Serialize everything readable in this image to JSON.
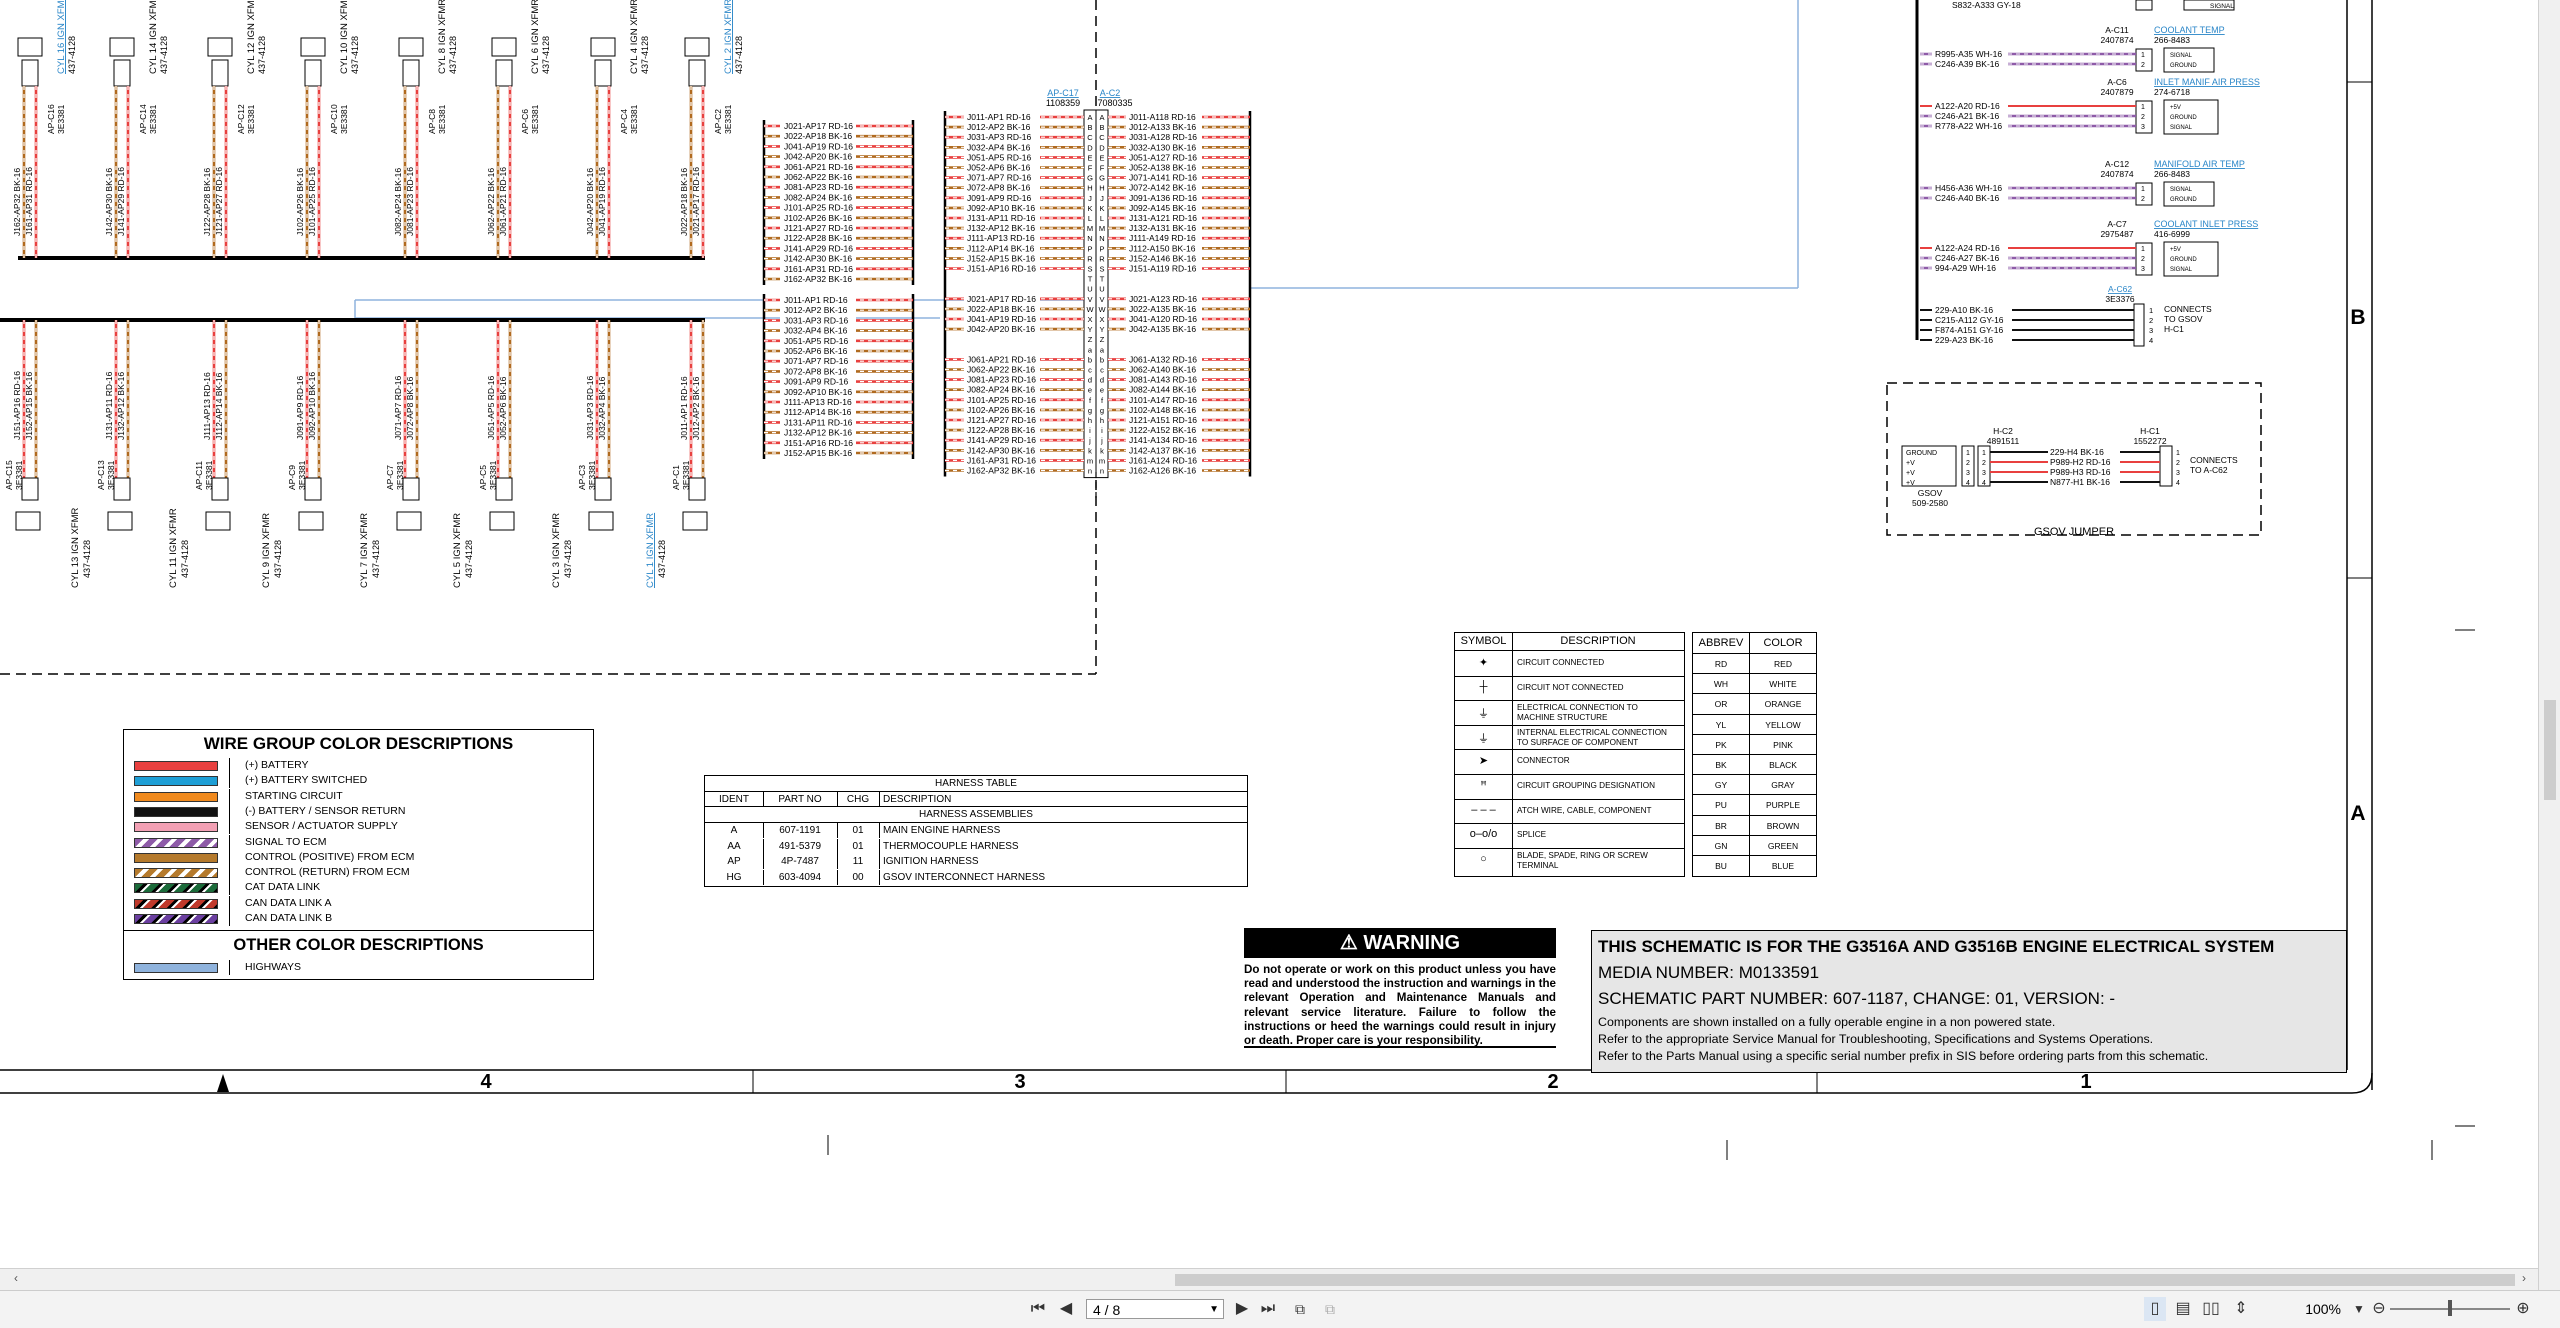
{
  "viewer": {
    "page_current": "4 / 8",
    "zoom_level": "100%"
  },
  "zones": {
    "columns": [
      "4",
      "3",
      "2",
      "1"
    ],
    "rows": [
      "B",
      "A"
    ]
  },
  "cylinders_top": [
    {
      "label": "CYL 16 IGN XFMR",
      "sub": "437-4128",
      "conn": "AP-C16",
      "part": "3E3381",
      "wires": [
        "J162-AP32 BK-16",
        "J161-AP31 RD-16"
      ],
      "link": true
    },
    {
      "label": "CYL 14 IGN XFMR",
      "sub": "437-4128",
      "conn": "AP-C14",
      "part": "3E3381",
      "wires": [
        "J142-AP30 BK-16",
        "J141-AP29 RD-16"
      ],
      "link": false
    },
    {
      "label": "CYL 12 IGN XFMR",
      "sub": "437-4128",
      "conn": "AP-C12",
      "part": "3E3381",
      "wires": [
        "J122-AP28 BK-16",
        "J121-AP27 RD-16"
      ],
      "link": false
    },
    {
      "label": "CYL 10 IGN XFMR",
      "sub": "437-4128",
      "conn": "AP-C10",
      "part": "3E3381",
      "wires": [
        "J102-AP26 BK-16",
        "J101-AP25 RD-16"
      ],
      "link": false
    },
    {
      "label": "CYL 8 IGN XFMR",
      "sub": "437-4128",
      "conn": "AP-C8",
      "part": "3E3381",
      "wires": [
        "J082-AP24 BK-16",
        "J081-AP23 RD-16"
      ],
      "link": false
    },
    {
      "label": "CYL 6 IGN XFMR",
      "sub": "437-4128",
      "conn": "AP-C6",
      "part": "3E3381",
      "wires": [
        "J062-AP22 BK-16",
        "J061-AP21 RD-16"
      ],
      "link": false
    },
    {
      "label": "CYL 4 IGN XFMR",
      "sub": "437-4128",
      "conn": "AP-C4",
      "part": "3E3381",
      "wires": [
        "J042-AP20 BK-16",
        "J041-AP19 RD-16"
      ],
      "link": false
    },
    {
      "label": "CYL 2 IGN XFMR",
      "sub": "437-4128",
      "conn": "AP-C2",
      "part": "3E3381",
      "wires": [
        "J022-AP18 BK-16",
        "J021-AP17 RD-16"
      ],
      "link": true
    }
  ],
  "cylinders_bottom": [
    {
      "label": "CYL 15 IGN XFMR",
      "sub": "437-4128",
      "conn": "AP-C15",
      "part": "3E3381",
      "wires": [
        "J151-AP16 RD-16",
        "J152-AP15 BK-16"
      ],
      "link": false
    },
    {
      "label": "CYL 13 IGN XFMR",
      "sub": "437-4128",
      "conn": "AP-C13",
      "part": "3E3381",
      "wires": [
        "J131-AP11 RD-16",
        "J132-AP12 BK-16"
      ],
      "link": false
    },
    {
      "label": "CYL 11 IGN XFMR",
      "sub": "437-4128",
      "conn": "AP-C11",
      "part": "3E3381",
      "wires": [
        "J111-AP13 RD-16",
        "J112-AP14 BK-16"
      ],
      "link": false
    },
    {
      "label": "CYL 9 IGN XFMR",
      "sub": "437-4128",
      "conn": "AP-C9",
      "part": "3E3381",
      "wires": [
        "J091-AP9 RD-16",
        "J092-AP10 BK-16"
      ],
      "link": false
    },
    {
      "label": "CYL 7 IGN XFMR",
      "sub": "437-4128",
      "conn": "AP-C7",
      "part": "3E3381",
      "wires": [
        "J071-AP7 RD-16",
        "J072-AP8 BK-16"
      ],
      "link": false
    },
    {
      "label": "CYL 5 IGN XFMR",
      "sub": "437-4128",
      "conn": "AP-C5",
      "part": "3E3381",
      "wires": [
        "J051-AP5 RD-16",
        "J052-AP6 BK-16"
      ],
      "link": false
    },
    {
      "label": "CYL 3 IGN XFMR",
      "sub": "437-4128",
      "conn": "AP-C3",
      "part": "3E3381",
      "wires": [
        "J031-AP3 RD-16",
        "J032-AP4 BK-16"
      ],
      "link": false
    },
    {
      "label": "CYL 1 IGN XFMR",
      "sub": "437-4128",
      "conn": "AP-C1",
      "part": "3E3381",
      "wires": [
        "J011-AP1 RD-16",
        "J012-AP2 BK-16"
      ],
      "link": true
    }
  ],
  "splice_group_upper": [
    "J021-AP17 RD-16",
    "J022-AP18 BK-16",
    "J041-AP19 RD-16",
    "J042-AP20 BK-16",
    "J061-AP21 RD-16",
    "J062-AP22 BK-16",
    "J081-AP23 RD-16",
    "J082-AP24 BK-16",
    "J101-AP25 RD-16",
    "J102-AP26 BK-16",
    "J121-AP27 RD-16",
    "J122-AP28 BK-16",
    "J141-AP29 RD-16",
    "J142-AP30 BK-16",
    "J161-AP31 RD-16",
    "J162-AP32 BK-16"
  ],
  "splice_group_lower": [
    "J011-AP1 RD-16",
    "J012-AP2 BK-16",
    "J031-AP3 RD-16",
    "J032-AP4 BK-16",
    "J051-AP5 RD-16",
    "J052-AP6 BK-16",
    "J071-AP7 RD-16",
    "J072-AP8 BK-16",
    "J091-AP9 RD-16",
    "J092-AP10 BK-16",
    "J111-AP13 RD-16",
    "J112-AP14 BK-16",
    "J131-AP11 RD-16",
    "J132-AP12 BK-16",
    "J151-AP16 RD-16",
    "J152-AP15 BK-16"
  ],
  "connector_apc17": {
    "name": "AP-C17",
    "part": "1108359"
  },
  "connector_ac2": {
    "name": "A-C2",
    "part": "7080335"
  },
  "apc17_left": [
    "J011-AP1 RD-16",
    "J012-AP2 BK-16",
    "J031-AP3 RD-16",
    "J032-AP4 BK-16",
    "J051-AP5 RD-16",
    "J052-AP6 BK-16",
    "J071-AP7 RD-16",
    "J072-AP8 BK-16",
    "J091-AP9 RD-16",
    "J092-AP10 BK-16",
    "J131-AP11 RD-16",
    "J132-AP12 BK-16",
    "J111-AP13 RD-16",
    "J112-AP14 BK-16",
    "J152-AP15 BK-16",
    "J151-AP16 RD-16",
    "",
    "",
    "J021-AP17 RD-16",
    "J022-AP18 BK-16",
    "J041-AP19 RD-16",
    "J042-AP20 BK-16",
    "",
    "",
    "J061-AP21 RD-16",
    "J062-AP22 BK-16",
    "J081-AP23 RD-16",
    "J082-AP24 BK-16",
    "J101-AP25 RD-16",
    "J102-AP26 BK-16",
    "J121-AP27 RD-16",
    "J122-AP28 BK-16",
    "J141-AP29 RD-16",
    "J142-AP30 BK-16",
    "J161-AP31 RD-16",
    "J162-AP32 BK-16"
  ],
  "ac2_right": [
    "J011-A118 RD-16",
    "J012-A133 BK-16",
    "J031-A128 RD-16",
    "J032-A130 BK-16",
    "J051-A127 RD-16",
    "J052-A138 BK-16",
    "J071-A141 RD-16",
    "J072-A142 BK-16",
    "J091-A136 RD-16",
    "J092-A145 BK-16",
    "J131-A121 RD-16",
    "J132-A131 BK-16",
    "J111-A149 RD-16",
    "J112-A150 BK-16",
    "J152-A146 BK-16",
    "J151-A119 RD-16",
    "",
    "",
    "J021-A123 RD-16",
    "J022-A135 BK-16",
    "J041-A120 RD-16",
    "J042-A135 BK-16",
    "",
    "",
    "J061-A132 RD-16",
    "J062-A140 BK-16",
    "J081-A143 RD-16",
    "J082-A144 BK-16",
    "J101-A147 RD-16",
    "J102-A148 BK-16",
    "J121-A151 RD-16",
    "J122-A152 BK-16",
    "J141-A134 RD-16",
    "J142-A137 BK-16",
    "J161-A124 RD-16",
    "J162-A126 BK-16"
  ],
  "pin_letters": [
    "A",
    "B",
    "C",
    "D",
    "E",
    "F",
    "G",
    "H",
    "J",
    "K",
    "L",
    "M",
    "N",
    "P",
    "R",
    "S",
    "T",
    "U",
    "V",
    "W",
    "X",
    "Y",
    "Z",
    "a",
    "b",
    "c",
    "d",
    "e",
    "f",
    "g",
    "h",
    "i",
    "j",
    "k",
    "m",
    "n"
  ],
  "sensors": [
    {
      "name": "COOLANT TEMP",
      "part": "266-8483",
      "conn": "A-C11",
      "conn_part": "2407874",
      "wires": [
        "R995-A35 WH-16",
        "C246-A39 BK-16"
      ],
      "pins": [
        "SIGNAL",
        "GROUND"
      ]
    },
    {
      "name": "INLET MANIF AIR PRESS",
      "part": "274-6718",
      "conn": "A-C6",
      "conn_part": "2407879",
      "wires": [
        "A122-A20 RD-16",
        "C246-A21 BK-16",
        "R778-A22 WH-16"
      ],
      "pins": [
        "+5V",
        "GROUND",
        "SIGNAL"
      ]
    },
    {
      "name": "MANIFOLD AIR TEMP",
      "part": "266-8483",
      "conn": "A-C12",
      "conn_part": "2407874",
      "wires": [
        "H456-A36 WH-16",
        "C246-A40 BK-16"
      ],
      "pins": [
        "SIGNAL",
        "GROUND"
      ]
    },
    {
      "name": "COOLANT INLET PRESS",
      "part": "416-6999",
      "conn": "A-C7",
      "conn_part": "2975487",
      "wires": [
        "A122-A24 RD-16",
        "C246-A27 BK-16",
        "994-A29 WH-16"
      ],
      "pins": [
        "+5V",
        "GROUND",
        "SIGNAL"
      ]
    }
  ],
  "top_right_wire": "S832-A333 GY-18",
  "top_right_pin": "SIGNAL",
  "gsov_conn": {
    "name": "A-C62",
    "part": "3E3376",
    "wires": [
      "229-A10 BK-16",
      "C215-A112 GY-16",
      "F874-A151 GY-16",
      "229-A23 BK-16"
    ],
    "note": [
      "CONNECTS",
      "TO GSOV",
      "H-C1"
    ]
  },
  "gsov_jumper": {
    "title": "GSOV JUMPER",
    "hc2": {
      "name": "H-C2",
      "part": "4891511"
    },
    "hc1": {
      "name": "H-C1",
      "part": "1552272"
    },
    "gsov": {
      "name": "GSOV",
      "part": "509-2580"
    },
    "gsov_pins": [
      "GROUND",
      "+V",
      "+V",
      "+V"
    ],
    "wires": [
      "229-H4 BK-16",
      "P989-H2 RD-16",
      "P989-H3 RD-16",
      "N877-H1 BK-16"
    ],
    "note": [
      "CONNECTS",
      "TO A-C62"
    ]
  },
  "wire_groups": {
    "title": "WIRE GROUP COLOR DESCRIPTIONS",
    "items": [
      {
        "label": "(+) BATTERY",
        "color": "#e8403f",
        "pattern": "solid"
      },
      {
        "label": "(+) BATTERY SWITCHED",
        "color": "#1e9fd6",
        "pattern": "solid"
      },
      {
        "label": "STARTING CIRCUIT",
        "color": "#f08a1e",
        "pattern": "solid"
      },
      {
        "label": "(-) BATTERY / SENSOR RETURN",
        "color": "#111111",
        "pattern": "solid"
      },
      {
        "label": "SENSOR / ACTUATOR SUPPLY",
        "color": "#f2a0b4",
        "pattern": "solid"
      },
      {
        "label": "SIGNAL TO ECM",
        "color": "#8e5ba8",
        "pattern": "stripe-white"
      },
      {
        "label": "CONTROL (POSITIVE) FROM ECM",
        "color": "#b57a2c",
        "pattern": "solid"
      },
      {
        "label": "CONTROL (RETURN) FROM ECM",
        "color": "#b57a2c",
        "pattern": "stripe-white"
      },
      {
        "label": "CAT DATA LINK",
        "color": "#1b6b3a",
        "pattern": "stripe-black"
      },
      {
        "label": "CAN DATA LINK A",
        "color": "#c0392b",
        "pattern": "stripe-black"
      },
      {
        "label": "CAN DATA LINK B",
        "color": "#6b3fa0",
        "pattern": "stripe-black"
      }
    ],
    "other_title": "OTHER COLOR DESCRIPTIONS",
    "other_items": [
      {
        "label": "HIGHWAYS",
        "color": "#8fb3dd",
        "pattern": "solid"
      }
    ]
  },
  "harness_table": {
    "title": "HARNESS TABLE",
    "headers": [
      "IDENT",
      "PART NO",
      "CHG",
      "DESCRIPTION"
    ],
    "section": "HARNESS ASSEMBLIES",
    "rows": [
      [
        "A",
        "607-1191",
        "01",
        "MAIN ENGINE HARNESS"
      ],
      [
        "AA",
        "491-5379",
        "01",
        "THERMOCOUPLE HARNESS"
      ],
      [
        "AP",
        "4P-7487",
        "11",
        "IGNITION HARNESS"
      ],
      [
        "HG",
        "603-4094",
        "00",
        "GSOV INTERCONNECT HARNESS"
      ]
    ]
  },
  "symbol_table": {
    "headers": [
      "SYMBOL",
      "DESCRIPTION"
    ],
    "rows": [
      {
        "symbol": "connected",
        "desc": [
          "CIRCUIT CONNECTED"
        ]
      },
      {
        "symbol": "not-connected",
        "desc": [
          "CIRCUIT NOT CONNECTED"
        ]
      },
      {
        "symbol": "ground-machine",
        "desc": [
          "ELECTRICAL CONNECTION TO",
          "MACHINE STRUCTURE"
        ]
      },
      {
        "symbol": "ground-component",
        "desc": [
          "INTERNAL ELECTRICAL CONNECTION",
          "TO SURFACE OF COMPONENT"
        ]
      },
      {
        "symbol": "connector",
        "desc": [
          "CONNECTOR"
        ]
      },
      {
        "symbol": "grouping",
        "desc": [
          "CIRCUIT GROUPING DESIGNATION"
        ]
      },
      {
        "symbol": "attach",
        "desc": [
          "ATCH WIRE, CABLE, COMPONENT"
        ]
      },
      {
        "symbol": "splice",
        "desc": [
          "SPLICE"
        ]
      },
      {
        "symbol": "terminal",
        "desc": [
          "BLADE, SPADE, RING OR SCREW",
          "TERMINAL"
        ]
      }
    ]
  },
  "abbrev_table": {
    "headers": [
      "ABBREV",
      "COLOR"
    ],
    "rows": [
      [
        "RD",
        "RED"
      ],
      [
        "WH",
        "WHITE"
      ],
      [
        "OR",
        "ORANGE"
      ],
      [
        "YL",
        "YELLOW"
      ],
      [
        "PK",
        "PINK"
      ],
      [
        "BK",
        "BLACK"
      ],
      [
        "GY",
        "GRAY"
      ],
      [
        "PU",
        "PURPLE"
      ],
      [
        "BR",
        "BROWN"
      ],
      [
        "GN",
        "GREEN"
      ],
      [
        "BU",
        "BLUE"
      ]
    ]
  },
  "warning": {
    "title": "WARNING",
    "body": "Do not operate or work on this product unless you have read and understood the instruction and warnings in the relevant Operation and Maintenance Manuals and relevant service literature. Failure to follow the instructions or heed the warnings could result in injury or death. Proper care is your responsibility."
  },
  "title_block": {
    "heading": "THIS SCHEMATIC IS FOR THE G3516A AND G3516B ENGINE ELECTRICAL SYSTEM",
    "media": "MEDIA NUMBER: M0133591",
    "part": "SCHEMATIC PART NUMBER: 607-1187, CHANGE: 01, VERSION: -",
    "notes": [
      "Components are shown installed on a fully operable engine in a non powered state.",
      "Refer to the appropriate Service Manual for Troubleshooting, Specifications and Systems Operations.",
      "Refer to the Parts Manual using a specific serial number prefix in SIS before ordering parts from this schematic."
    ]
  },
  "colors": {
    "wire_red": "#e8403f",
    "wire_brown": "#b06a1f",
    "highway": "#8fb3dd",
    "link": "#2a86c8"
  }
}
